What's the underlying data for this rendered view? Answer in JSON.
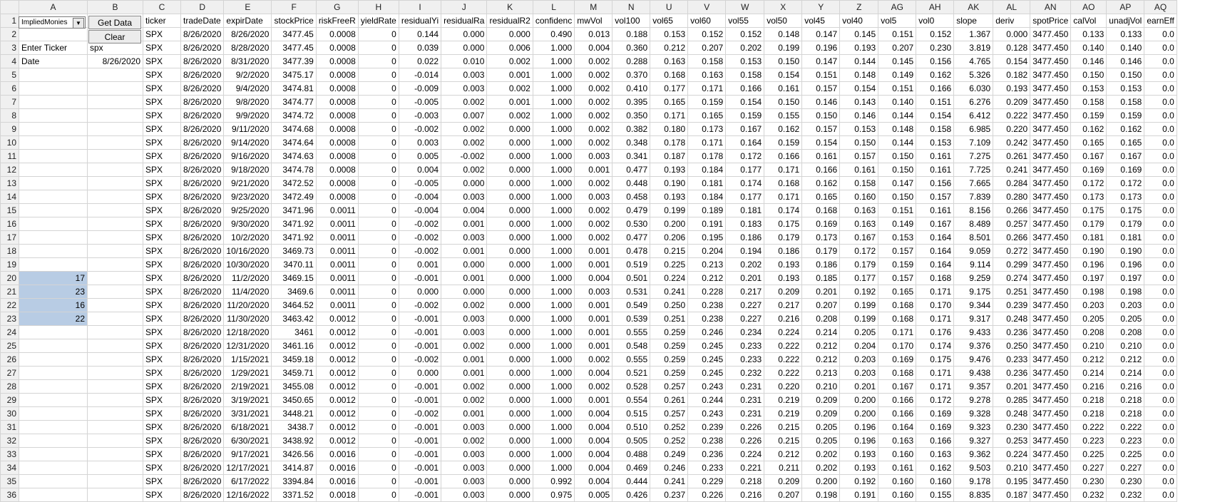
{
  "sheet": {
    "columns": [
      "A",
      "B",
      "C",
      "D",
      "E",
      "F",
      "G",
      "H",
      "I",
      "J",
      "K",
      "L",
      "M",
      "N",
      "U",
      "V",
      "W",
      "X",
      "Y",
      "Z",
      "AG",
      "AH",
      "AK",
      "AL",
      "AN",
      "AO",
      "AP",
      "AQ"
    ],
    "controls": {
      "dropdown_value": "ImpliedMonies",
      "get_data_label": "Get Data",
      "clear_label": "Clear"
    },
    "side_cells": {
      "ticker_label": "Enter Ticker",
      "ticker_value": "spx",
      "date_label": "Date",
      "date_value": "8/26/2020",
      "selected_values": [
        "17",
        "23",
        "16",
        "22"
      ]
    },
    "headers": [
      "ticker",
      "tradeDate",
      "expirDate",
      "stockPrice",
      "riskFreeR",
      "yieldRate",
      "residualYi",
      "residualRa",
      "residualR2",
      "confidenc",
      "mwVol",
      "vol100",
      "vol65",
      "vol60",
      "vol55",
      "vol50",
      "vol45",
      "vol40",
      "vol5",
      "vol0",
      "slope",
      "deriv",
      "spotPrice",
      "calVol",
      "unadjVol",
      "earnEff"
    ],
    "rows": [
      [
        "SPX",
        "8/26/2020",
        "8/26/2020",
        "3477.45",
        "0.0008",
        "0",
        "0.144",
        "0.000",
        "0.000",
        "0.490",
        "0.013",
        "0.188",
        "0.153",
        "0.152",
        "0.152",
        "0.148",
        "0.147",
        "0.145",
        "0.151",
        "0.152",
        "1.367",
        "0.000",
        "3477.450",
        "0.133",
        "0.133",
        "0.0"
      ],
      [
        "SPX",
        "8/26/2020",
        "8/28/2020",
        "3477.45",
        "0.0008",
        "0",
        "0.039",
        "0.000",
        "0.006",
        "1.000",
        "0.004",
        "0.360",
        "0.212",
        "0.207",
        "0.202",
        "0.199",
        "0.196",
        "0.193",
        "0.207",
        "0.230",
        "3.819",
        "0.128",
        "3477.450",
        "0.140",
        "0.140",
        "0.0"
      ],
      [
        "SPX",
        "8/26/2020",
        "8/31/2020",
        "3477.39",
        "0.0008",
        "0",
        "0.022",
        "0.010",
        "0.002",
        "1.000",
        "0.002",
        "0.288",
        "0.163",
        "0.158",
        "0.153",
        "0.150",
        "0.147",
        "0.144",
        "0.145",
        "0.156",
        "4.765",
        "0.154",
        "3477.450",
        "0.146",
        "0.146",
        "0.0"
      ],
      [
        "SPX",
        "8/26/2020",
        "9/2/2020",
        "3475.17",
        "0.0008",
        "0",
        "-0.014",
        "0.003",
        "0.001",
        "1.000",
        "0.002",
        "0.370",
        "0.168",
        "0.163",
        "0.158",
        "0.154",
        "0.151",
        "0.148",
        "0.149",
        "0.162",
        "5.326",
        "0.182",
        "3477.450",
        "0.150",
        "0.150",
        "0.0"
      ],
      [
        "SPX",
        "8/26/2020",
        "9/4/2020",
        "3474.81",
        "0.0008",
        "0",
        "-0.009",
        "0.003",
        "0.002",
        "1.000",
        "0.002",
        "0.410",
        "0.177",
        "0.171",
        "0.166",
        "0.161",
        "0.157",
        "0.154",
        "0.151",
        "0.166",
        "6.030",
        "0.193",
        "3477.450",
        "0.153",
        "0.153",
        "0.0"
      ],
      [
        "SPX",
        "8/26/2020",
        "9/8/2020",
        "3474.77",
        "0.0008",
        "0",
        "-0.005",
        "0.002",
        "0.001",
        "1.000",
        "0.002",
        "0.395",
        "0.165",
        "0.159",
        "0.154",
        "0.150",
        "0.146",
        "0.143",
        "0.140",
        "0.151",
        "6.276",
        "0.209",
        "3477.450",
        "0.158",
        "0.158",
        "0.0"
      ],
      [
        "SPX",
        "8/26/2020",
        "9/9/2020",
        "3474.72",
        "0.0008",
        "0",
        "-0.003",
        "0.007",
        "0.002",
        "1.000",
        "0.002",
        "0.350",
        "0.171",
        "0.165",
        "0.159",
        "0.155",
        "0.150",
        "0.146",
        "0.144",
        "0.154",
        "6.412",
        "0.222",
        "3477.450",
        "0.159",
        "0.159",
        "0.0"
      ],
      [
        "SPX",
        "8/26/2020",
        "9/11/2020",
        "3474.68",
        "0.0008",
        "0",
        "-0.002",
        "0.002",
        "0.000",
        "1.000",
        "0.002",
        "0.382",
        "0.180",
        "0.173",
        "0.167",
        "0.162",
        "0.157",
        "0.153",
        "0.148",
        "0.158",
        "6.985",
        "0.220",
        "3477.450",
        "0.162",
        "0.162",
        "0.0"
      ],
      [
        "SPX",
        "8/26/2020",
        "9/14/2020",
        "3474.64",
        "0.0008",
        "0",
        "0.003",
        "0.002",
        "0.000",
        "1.000",
        "0.002",
        "0.348",
        "0.178",
        "0.171",
        "0.164",
        "0.159",
        "0.154",
        "0.150",
        "0.144",
        "0.153",
        "7.109",
        "0.242",
        "3477.450",
        "0.165",
        "0.165",
        "0.0"
      ],
      [
        "SPX",
        "8/26/2020",
        "9/16/2020",
        "3474.63",
        "0.0008",
        "0",
        "0.005",
        "-0.002",
        "0.000",
        "1.000",
        "0.003",
        "0.341",
        "0.187",
        "0.178",
        "0.172",
        "0.166",
        "0.161",
        "0.157",
        "0.150",
        "0.161",
        "7.275",
        "0.261",
        "3477.450",
        "0.167",
        "0.167",
        "0.0"
      ],
      [
        "SPX",
        "8/26/2020",
        "9/18/2020",
        "3474.78",
        "0.0008",
        "0",
        "0.004",
        "0.002",
        "0.000",
        "1.000",
        "0.001",
        "0.477",
        "0.193",
        "0.184",
        "0.177",
        "0.171",
        "0.166",
        "0.161",
        "0.150",
        "0.161",
        "7.725",
        "0.241",
        "3477.450",
        "0.169",
        "0.169",
        "0.0"
      ],
      [
        "SPX",
        "8/26/2020",
        "9/21/2020",
        "3472.52",
        "0.0008",
        "0",
        "-0.005",
        "0.000",
        "0.000",
        "1.000",
        "0.002",
        "0.448",
        "0.190",
        "0.181",
        "0.174",
        "0.168",
        "0.162",
        "0.158",
        "0.147",
        "0.156",
        "7.665",
        "0.284",
        "3477.450",
        "0.172",
        "0.172",
        "0.0"
      ],
      [
        "SPX",
        "8/26/2020",
        "9/23/2020",
        "3472.49",
        "0.0008",
        "0",
        "-0.004",
        "0.003",
        "0.000",
        "1.000",
        "0.003",
        "0.458",
        "0.193",
        "0.184",
        "0.177",
        "0.171",
        "0.165",
        "0.160",
        "0.150",
        "0.157",
        "7.839",
        "0.280",
        "3477.450",
        "0.173",
        "0.173",
        "0.0"
      ],
      [
        "SPX",
        "8/26/2020",
        "9/25/2020",
        "3471.96",
        "0.0011",
        "0",
        "-0.004",
        "0.004",
        "0.000",
        "1.000",
        "0.002",
        "0.479",
        "0.199",
        "0.189",
        "0.181",
        "0.174",
        "0.168",
        "0.163",
        "0.151",
        "0.161",
        "8.156",
        "0.266",
        "3477.450",
        "0.175",
        "0.175",
        "0.0"
      ],
      [
        "SPX",
        "8/26/2020",
        "9/30/2020",
        "3471.92",
        "0.0011",
        "0",
        "-0.002",
        "0.001",
        "0.000",
        "1.000",
        "0.002",
        "0.530",
        "0.200",
        "0.191",
        "0.183",
        "0.175",
        "0.169",
        "0.163",
        "0.149",
        "0.167",
        "8.489",
        "0.257",
        "3477.450",
        "0.179",
        "0.179",
        "0.0"
      ],
      [
        "SPX",
        "8/26/2020",
        "10/2/2020",
        "3471.92",
        "0.0011",
        "0",
        "-0.002",
        "0.003",
        "0.000",
        "1.000",
        "0.002",
        "0.477",
        "0.206",
        "0.195",
        "0.186",
        "0.179",
        "0.173",
        "0.167",
        "0.153",
        "0.164",
        "8.501",
        "0.266",
        "3477.450",
        "0.181",
        "0.181",
        "0.0"
      ],
      [
        "SPX",
        "8/26/2020",
        "10/16/2020",
        "3469.73",
        "0.0011",
        "0",
        "-0.002",
        "0.001",
        "0.000",
        "1.000",
        "0.001",
        "0.478",
        "0.215",
        "0.204",
        "0.194",
        "0.186",
        "0.179",
        "0.172",
        "0.157",
        "0.164",
        "9.059",
        "0.272",
        "3477.450",
        "0.190",
        "0.190",
        "0.0"
      ],
      [
        "SPX",
        "8/26/2020",
        "10/30/2020",
        "3470.11",
        "0.0011",
        "0",
        "0.001",
        "0.000",
        "0.000",
        "1.000",
        "0.001",
        "0.519",
        "0.225",
        "0.213",
        "0.202",
        "0.193",
        "0.186",
        "0.179",
        "0.159",
        "0.164",
        "9.114",
        "0.299",
        "3477.450",
        "0.196",
        "0.196",
        "0.0"
      ],
      [
        "SPX",
        "8/26/2020",
        "11/2/2020",
        "3469.15",
        "0.0011",
        "0",
        "-0.001",
        "0.001",
        "0.000",
        "1.000",
        "0.004",
        "0.501",
        "0.224",
        "0.212",
        "0.201",
        "0.193",
        "0.185",
        "0.177",
        "0.157",
        "0.168",
        "9.259",
        "0.274",
        "3477.450",
        "0.197",
        "0.197",
        "0.0"
      ],
      [
        "SPX",
        "8/26/2020",
        "11/4/2020",
        "3469.6",
        "0.0011",
        "0",
        "0.000",
        "0.000",
        "0.000",
        "1.000",
        "0.003",
        "0.531",
        "0.241",
        "0.228",
        "0.217",
        "0.209",
        "0.201",
        "0.192",
        "0.165",
        "0.171",
        "9.175",
        "0.251",
        "3477.450",
        "0.198",
        "0.198",
        "0.0"
      ],
      [
        "SPX",
        "8/26/2020",
        "11/20/2020",
        "3464.52",
        "0.0011",
        "0",
        "-0.002",
        "0.002",
        "0.000",
        "1.000",
        "0.001",
        "0.549",
        "0.250",
        "0.238",
        "0.227",
        "0.217",
        "0.207",
        "0.199",
        "0.168",
        "0.170",
        "9.344",
        "0.239",
        "3477.450",
        "0.203",
        "0.203",
        "0.0"
      ],
      [
        "SPX",
        "8/26/2020",
        "11/30/2020",
        "3463.42",
        "0.0012",
        "0",
        "-0.001",
        "0.003",
        "0.000",
        "1.000",
        "0.001",
        "0.539",
        "0.251",
        "0.238",
        "0.227",
        "0.216",
        "0.208",
        "0.199",
        "0.168",
        "0.171",
        "9.317",
        "0.248",
        "3477.450",
        "0.205",
        "0.205",
        "0.0"
      ],
      [
        "SPX",
        "8/26/2020",
        "12/18/2020",
        "3461",
        "0.0012",
        "0",
        "-0.001",
        "0.003",
        "0.000",
        "1.000",
        "0.001",
        "0.555",
        "0.259",
        "0.246",
        "0.234",
        "0.224",
        "0.214",
        "0.205",
        "0.171",
        "0.176",
        "9.433",
        "0.236",
        "3477.450",
        "0.208",
        "0.208",
        "0.0"
      ],
      [
        "SPX",
        "8/26/2020",
        "12/31/2020",
        "3461.16",
        "0.0012",
        "0",
        "-0.001",
        "0.002",
        "0.000",
        "1.000",
        "0.001",
        "0.548",
        "0.259",
        "0.245",
        "0.233",
        "0.222",
        "0.212",
        "0.204",
        "0.170",
        "0.174",
        "9.376",
        "0.250",
        "3477.450",
        "0.210",
        "0.210",
        "0.0"
      ],
      [
        "SPX",
        "8/26/2020",
        "1/15/2021",
        "3459.18",
        "0.0012",
        "0",
        "-0.002",
        "0.001",
        "0.000",
        "1.000",
        "0.002",
        "0.555",
        "0.259",
        "0.245",
        "0.233",
        "0.222",
        "0.212",
        "0.203",
        "0.169",
        "0.175",
        "9.476",
        "0.233",
        "3477.450",
        "0.212",
        "0.212",
        "0.0"
      ],
      [
        "SPX",
        "8/26/2020",
        "1/29/2021",
        "3459.71",
        "0.0012",
        "0",
        "0.000",
        "0.001",
        "0.000",
        "1.000",
        "0.004",
        "0.521",
        "0.259",
        "0.245",
        "0.232",
        "0.222",
        "0.213",
        "0.203",
        "0.168",
        "0.171",
        "9.438",
        "0.236",
        "3477.450",
        "0.214",
        "0.214",
        "0.0"
      ],
      [
        "SPX",
        "8/26/2020",
        "2/19/2021",
        "3455.08",
        "0.0012",
        "0",
        "-0.001",
        "0.002",
        "0.000",
        "1.000",
        "0.002",
        "0.528",
        "0.257",
        "0.243",
        "0.231",
        "0.220",
        "0.210",
        "0.201",
        "0.167",
        "0.171",
        "9.357",
        "0.201",
        "3477.450",
        "0.216",
        "0.216",
        "0.0"
      ],
      [
        "SPX",
        "8/26/2020",
        "3/19/2021",
        "3450.65",
        "0.0012",
        "0",
        "-0.001",
        "0.002",
        "0.000",
        "1.000",
        "0.001",
        "0.554",
        "0.261",
        "0.244",
        "0.231",
        "0.219",
        "0.209",
        "0.200",
        "0.166",
        "0.172",
        "9.278",
        "0.285",
        "3477.450",
        "0.218",
        "0.218",
        "0.0"
      ],
      [
        "SPX",
        "8/26/2020",
        "3/31/2021",
        "3448.21",
        "0.0012",
        "0",
        "-0.002",
        "0.001",
        "0.000",
        "1.000",
        "0.004",
        "0.515",
        "0.257",
        "0.243",
        "0.231",
        "0.219",
        "0.209",
        "0.200",
        "0.166",
        "0.169",
        "9.328",
        "0.248",
        "3477.450",
        "0.218",
        "0.218",
        "0.0"
      ],
      [
        "SPX",
        "8/26/2020",
        "6/18/2021",
        "3438.7",
        "0.0012",
        "0",
        "-0.001",
        "0.003",
        "0.000",
        "1.000",
        "0.004",
        "0.510",
        "0.252",
        "0.239",
        "0.226",
        "0.215",
        "0.205",
        "0.196",
        "0.164",
        "0.169",
        "9.323",
        "0.230",
        "3477.450",
        "0.222",
        "0.222",
        "0.0"
      ],
      [
        "SPX",
        "8/26/2020",
        "6/30/2021",
        "3438.92",
        "0.0012",
        "0",
        "-0.001",
        "0.002",
        "0.000",
        "1.000",
        "0.004",
        "0.505",
        "0.252",
        "0.238",
        "0.226",
        "0.215",
        "0.205",
        "0.196",
        "0.163",
        "0.166",
        "9.327",
        "0.253",
        "3477.450",
        "0.223",
        "0.223",
        "0.0"
      ],
      [
        "SPX",
        "8/26/2020",
        "9/17/2021",
        "3426.56",
        "0.0016",
        "0",
        "-0.001",
        "0.003",
        "0.000",
        "1.000",
        "0.004",
        "0.488",
        "0.249",
        "0.236",
        "0.224",
        "0.212",
        "0.202",
        "0.193",
        "0.160",
        "0.163",
        "9.362",
        "0.224",
        "3477.450",
        "0.225",
        "0.225",
        "0.0"
      ],
      [
        "SPX",
        "8/26/2020",
        "12/17/2021",
        "3414.87",
        "0.0016",
        "0",
        "-0.001",
        "0.003",
        "0.000",
        "1.000",
        "0.004",
        "0.469",
        "0.246",
        "0.233",
        "0.221",
        "0.211",
        "0.202",
        "0.193",
        "0.161",
        "0.162",
        "9.503",
        "0.210",
        "3477.450",
        "0.227",
        "0.227",
        "0.0"
      ],
      [
        "SPX",
        "8/26/2020",
        "6/17/2022",
        "3394.84",
        "0.0016",
        "0",
        "-0.001",
        "0.003",
        "0.000",
        "0.992",
        "0.004",
        "0.444",
        "0.241",
        "0.229",
        "0.218",
        "0.209",
        "0.200",
        "0.192",
        "0.160",
        "0.160",
        "9.178",
        "0.195",
        "3477.450",
        "0.230",
        "0.230",
        "0.0"
      ],
      [
        "SPX",
        "8/26/2020",
        "12/16/2022",
        "3371.52",
        "0.0018",
        "0",
        "-0.001",
        "0.003",
        "0.000",
        "0.975",
        "0.005",
        "0.426",
        "0.237",
        "0.226",
        "0.216",
        "0.207",
        "0.198",
        "0.191",
        "0.160",
        "0.155",
        "8.835",
        "0.187",
        "3477.450",
        "0.232",
        "0.232",
        "0.0"
      ]
    ]
  }
}
